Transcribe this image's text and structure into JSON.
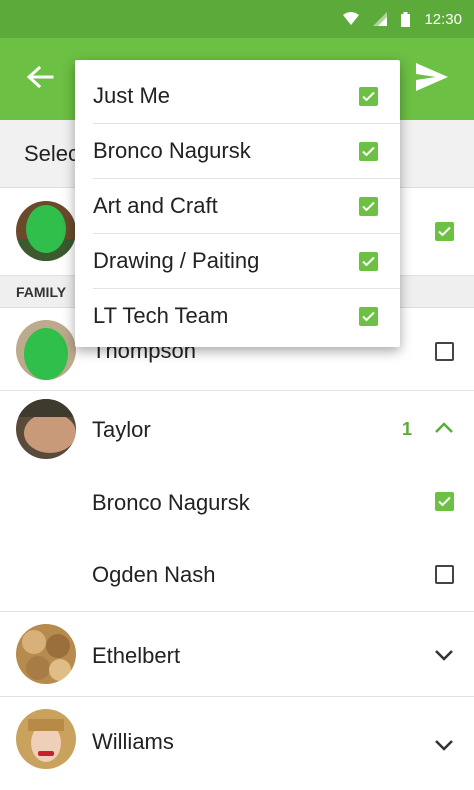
{
  "status_bar": {
    "time": "12:30",
    "icons": [
      "wifi-icon",
      "signal-icon",
      "battery-icon"
    ]
  },
  "app_bar": {
    "back_icon": "arrow-left-icon",
    "send_icon": "send-icon"
  },
  "select_bar": {
    "label": "Selec"
  },
  "top_contact": {
    "checked": true
  },
  "section": {
    "family_label": "FAMILY"
  },
  "contacts": [
    {
      "name": "Thompson",
      "checked": false
    },
    {
      "name": "Taylor",
      "count": "1",
      "expanded": true,
      "members": [
        {
          "name": "Bronco Nagursk",
          "checked": true
        },
        {
          "name": "Ogden Nash",
          "checked": false
        }
      ]
    },
    {
      "name": "Ethelbert",
      "expanded": false
    },
    {
      "name": "Williams",
      "expanded": false
    }
  ],
  "dropdown": {
    "items": [
      {
        "label": "Just Me",
        "checked": true
      },
      {
        "label": "Bronco Nagursk",
        "checked": true
      },
      {
        "label": "Art and Craft",
        "checked": true
      },
      {
        "label": "Drawing / Paiting",
        "checked": true
      },
      {
        "label": "LT Tech Team",
        "checked": true
      }
    ]
  },
  "colors": {
    "status_green": "#5cab3a",
    "appbar_green": "#6cc043",
    "check_green": "#6cc043"
  }
}
